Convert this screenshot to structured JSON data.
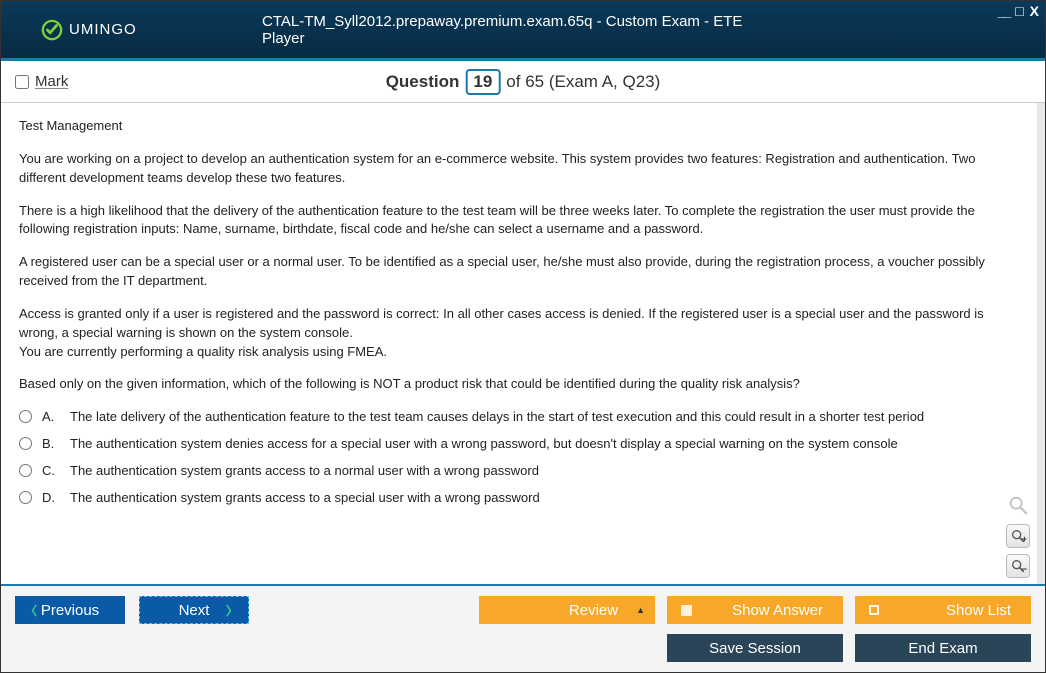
{
  "window_controls": {
    "min": "__",
    "max": "□",
    "close": "X"
  },
  "header": {
    "brand": "UMINGO",
    "title": "CTAL-TM_Syll2012.prepaway.premium.exam.65q - Custom Exam - ETE Player"
  },
  "qbar": {
    "mark_label": "Mark",
    "question_word": "Question",
    "current": "19",
    "total_text": "of 65 (Exam A, Q23)"
  },
  "question": {
    "topic": "Test Management",
    "paragraphs": [
      "You are working on a project to develop an authentication system for an e-commerce website. This system provides two features: Registration and authentication. Two different development teams develop these two features.",
      "There is a high likelihood that the delivery of the authentication feature to the test team will be three weeks later. To complete the registration the user must provide the following registration inputs: Name, surname, birthdate, fiscal code and he/she can select a username and a password.",
      "A registered user can be a special user or a normal user. To be identified as a special user, he/she must also provide, during the registration process, a voucher possibly received from the IT department."
    ],
    "para_tight1": "Access is granted only if a user is registered and the password is correct: In all other cases access is denied. If the registered user is a special user and the password is wrong,  a special warning is shown on the system console.",
    "para_tight2": "You are currently performing a quality risk analysis using FMEA.",
    "prompt": "Based only on the given information, which of the following is NOT a product risk that could be identified during the quality risk analysis?",
    "options": [
      {
        "letter": "A.",
        "text": "The late delivery of the authentication feature to the test team causes delays in the start of test execution and this could result in a shorter test period"
      },
      {
        "letter": "B.",
        "text": "The authentication system denies access for a special user with a wrong password, but doesn't display a special warning on the system console"
      },
      {
        "letter": "C.",
        "text": "The authentication system grants access to a normal user with a wrong password"
      },
      {
        "letter": "D.",
        "text": "The authentication system grants access to a special user with a wrong password"
      }
    ]
  },
  "footer": {
    "previous": "Previous",
    "next": "Next",
    "review": "Review",
    "show_answer": "Show Answer",
    "show_list": "Show List",
    "save_session": "Save Session",
    "end_exam": "End Exam"
  }
}
